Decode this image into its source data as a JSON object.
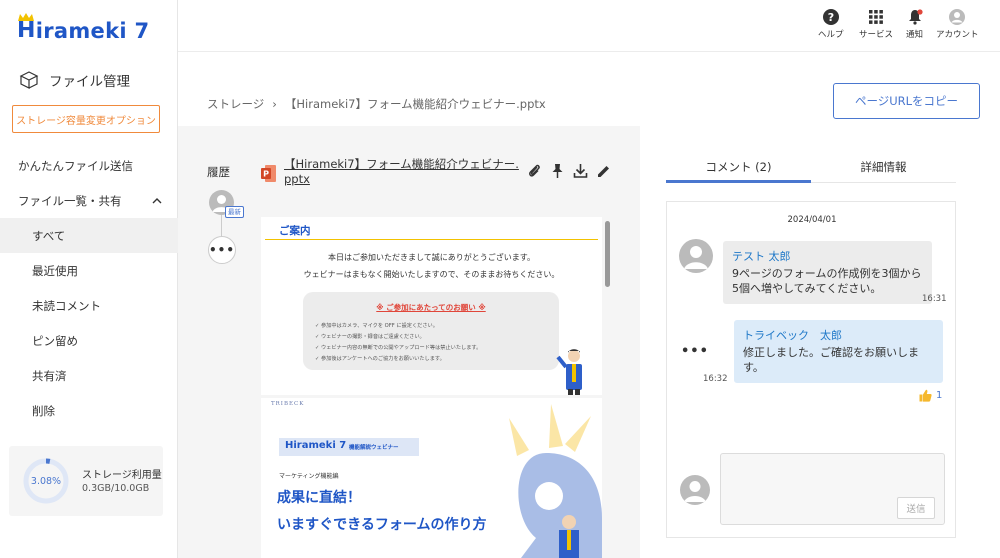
{
  "sidebar": {
    "logo": {
      "prefix": "H",
      "rest": "irameki 7"
    },
    "section_title": "ファイル管理",
    "storage_option_button": "ストレージ容量変更オプション",
    "nav": {
      "send": "かんたんファイル送信",
      "list_share": "ファイル一覧・共有",
      "all": "すべて",
      "recent": "最近使用",
      "unread": "未読コメント",
      "pinned": "ピン留め",
      "shared": "共有済",
      "deleted": "削除"
    },
    "storage": {
      "percent_text": "3.08%",
      "percent": 3.08,
      "label": "ストレージ利用量",
      "value": "0.3GB/10.0GB"
    }
  },
  "topbar": {
    "help": "ヘルプ",
    "service": "サービス",
    "notice": "通知",
    "account": "アカウント"
  },
  "breadcrumb": {
    "root": "ストレージ",
    "sep": "›",
    "current": "【Hirameki7】フォーム機能紹介ウェビナー.pptx"
  },
  "copy_url_button": "ページURLをコピー",
  "preview": {
    "history_label": "履歴",
    "new_badge": "最新",
    "file_name": "【Hirameki7】フォーム機能紹介ウェビナー.pptx",
    "slide1": {
      "title": "ご案内",
      "line1": "本日はご参加いただきまして誠にありがとうございます。",
      "line2": "ウェビナーはまもなく開始いたしますので、そのままお待ちください。",
      "box_title": "※ ご参加にあたってのお願い ※",
      "items": [
        "✓  参加中はカメラ、マイクを OFF に設定ください。",
        "✓  ウェビナーの撮影・録音はご遠慮ください。",
        "✓  ウェビナー内容の無断での公開やアップロード等は禁止いたします。",
        "✓  参加後はアンケートへのご協力をお願いいたします。"
      ]
    },
    "slide2": {
      "brand": "TRIBECK",
      "logo": "Hirameki 7",
      "logo_sub": "機能解説ウェビナー",
      "category": "マーケティング機能編",
      "headline1": "成果に直結！",
      "headline2": "いますぐできるフォームの作り方"
    }
  },
  "tabs": {
    "comments": "コメント (2)",
    "details": "詳細情報"
  },
  "comments": {
    "date": "2024/04/01",
    "items": [
      {
        "author": "テスト 太郎",
        "text": "9ページのフォームの作成例を3個から5個へ増やしてみてください。",
        "time": "16:31"
      },
      {
        "author": "トライベック　太郎",
        "text": "修正しました。ご確認をお願いします。",
        "time": "16:32",
        "likes": "1"
      }
    ],
    "more": "•••",
    "send_button": "送信"
  },
  "colors": {
    "brand": "#1f56c6",
    "accent": "#4a77cf",
    "orange": "#f08a3c",
    "notice": "#e0463a"
  }
}
